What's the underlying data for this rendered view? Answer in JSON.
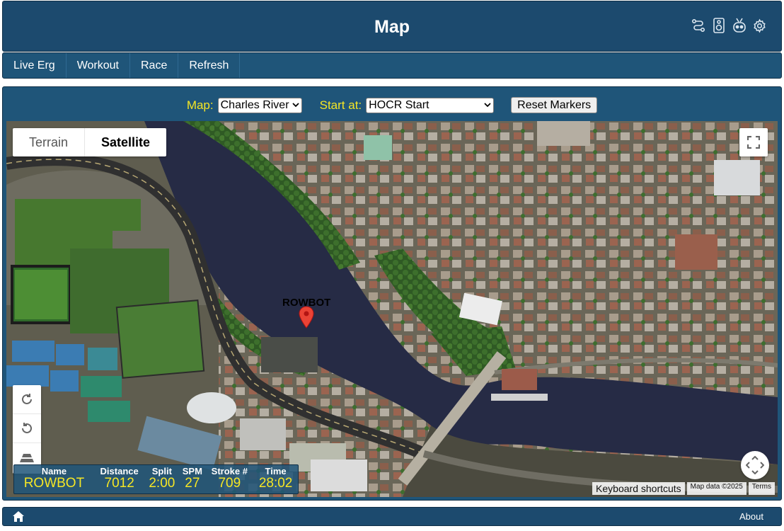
{
  "header": {
    "title": "Map",
    "icons": [
      "route-icon",
      "speaker-icon",
      "robot-icon",
      "gear-icon"
    ]
  },
  "nav": {
    "items": [
      {
        "label": "Live Erg"
      },
      {
        "label": "Workout"
      },
      {
        "label": "Race"
      },
      {
        "label": "Refresh"
      }
    ]
  },
  "controls": {
    "map_label": "Map:",
    "map_value": "Charles River",
    "start_label": "Start at:",
    "start_value": "HOCR Start",
    "reset_label": "Reset Markers"
  },
  "map": {
    "type_terrain": "Terrain",
    "type_satellite": "Satellite",
    "selected_type": "Satellite",
    "marker_label": "ROWBOT",
    "keyboard_shortcuts": "Keyboard shortcuts",
    "map_data": "Map data ©2025",
    "terms": "Terms"
  },
  "stats": {
    "headers": {
      "name": "Name",
      "distance": "Distance",
      "split": "Split",
      "spm": "SPM",
      "stroke": "Stroke #",
      "time": "Time"
    },
    "row": {
      "name": "ROWBOT",
      "distance": "7012",
      "split": "2:00",
      "spm": "27",
      "stroke": "709",
      "time": "28:02"
    }
  },
  "footer": {
    "about": "About"
  },
  "colors": {
    "header_bg": "#1c4a6e",
    "nav_bg": "#1f5579",
    "accent_yellow": "#f5e625"
  }
}
